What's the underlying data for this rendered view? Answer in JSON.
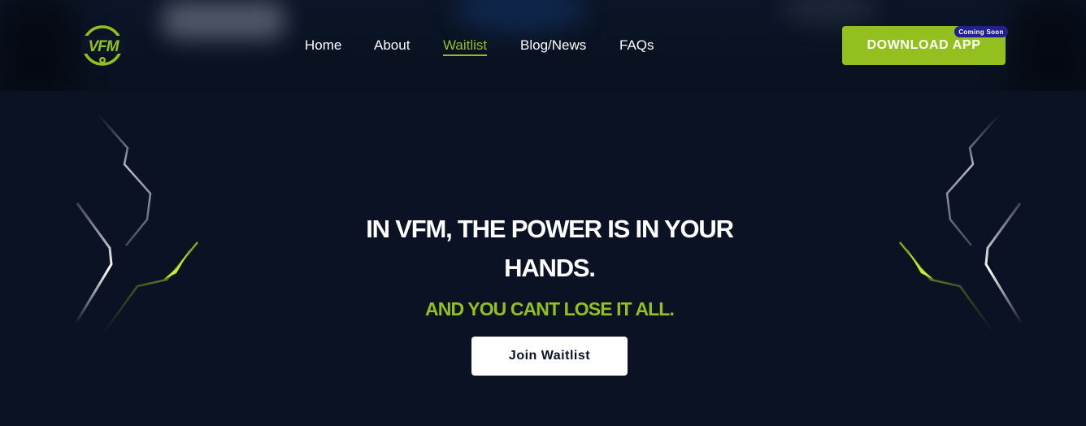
{
  "brand": {
    "logo_text": "VFM",
    "accent_color": "#93c01f",
    "background_color": "#0a1224",
    "badge_color": "#23218f"
  },
  "nav": {
    "items": [
      {
        "label": "Home",
        "active": false
      },
      {
        "label": "About",
        "active": false
      },
      {
        "label": "Waitlist",
        "active": true
      },
      {
        "label": "Blog/News",
        "active": false
      },
      {
        "label": "FAQs",
        "active": false
      }
    ]
  },
  "header": {
    "download_label": "DOWNLOAD APP",
    "badge_label": "Coming Soon"
  },
  "hero": {
    "headline_line1": "IN VFM, THE POWER IS IN YOUR",
    "headline_line2": "HANDS.",
    "tagline": "AND YOU CANT LOSE IT ALL.",
    "cta_label": "Join Waitlist"
  },
  "icons": {
    "logo": "vfm-logo-icon",
    "decor_left": "lightning-decoration-left",
    "decor_right": "lightning-decoration-right"
  }
}
